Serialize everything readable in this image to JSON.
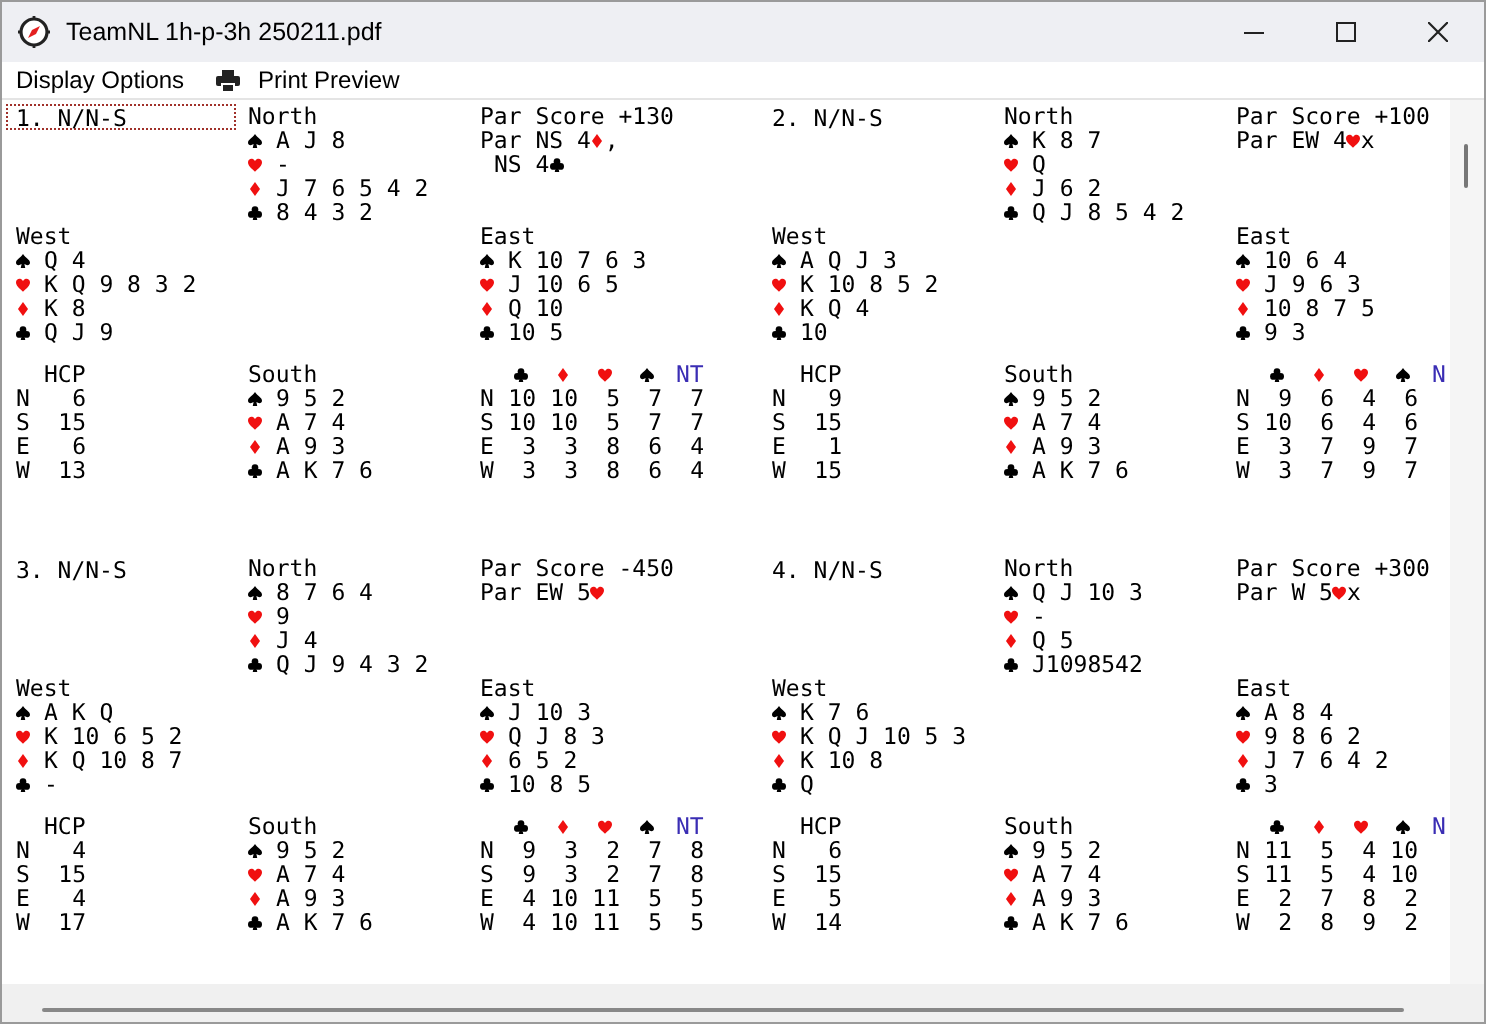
{
  "window": {
    "title": "TeamNL 1h-p-3h 250211.pdf"
  },
  "menu": [
    {
      "label": "Display Options",
      "kind": "text"
    },
    {
      "label": "Print Preview",
      "kind": "printer"
    }
  ],
  "boards": [
    {
      "header": "1. N/N-S",
      "focused": true,
      "north": {
        "label": "North",
        "suits": [
          {
            "kind": "spade",
            "cards": "A J 8"
          },
          {
            "kind": "heart",
            "cards": "-"
          },
          {
            "kind": "diamond",
            "cards": "J 7 6 5 4 2"
          },
          {
            "kind": "club",
            "cards": "8 4 3 2"
          }
        ]
      },
      "par": {
        "title": "Par Score +130",
        "contracts": [
          {
            "prefix": "Par NS 4",
            "kind": "diamond",
            "suffix": ","
          },
          {
            "prefix": "NS 4",
            "kind": "club"
          }
        ]
      },
      "west": {
        "label": "West",
        "suits": [
          {
            "kind": "spade",
            "cards": "Q 4"
          },
          {
            "kind": "heart",
            "cards": "K Q 9 8 3 2"
          },
          {
            "kind": "diamond",
            "cards": "K 8"
          },
          {
            "kind": "club",
            "cards": "Q J 9"
          }
        ]
      },
      "east": {
        "label": "East",
        "suits": [
          {
            "kind": "spade",
            "cards": "K 10 7 6 3"
          },
          {
            "kind": "heart",
            "cards": "J 10 6 5"
          },
          {
            "kind": "diamond",
            "cards": "Q 10"
          },
          {
            "kind": "club",
            "cards": "10 5"
          }
        ]
      },
      "hcp": {
        "title": "HCP",
        "rows": [
          {
            "seat": "N",
            "value": "6"
          },
          {
            "seat": "S",
            "value": "15"
          },
          {
            "seat": "E",
            "value": "6"
          },
          {
            "seat": "W",
            "value": "13"
          }
        ]
      },
      "south": {
        "label": "South",
        "suits": [
          {
            "kind": "spade",
            "cards": "9 5 2"
          },
          {
            "kind": "heart",
            "cards": "A 7 4"
          },
          {
            "kind": "diamond",
            "cards": "A 9 3"
          },
          {
            "kind": "club",
            "cards": "A K 7 6"
          }
        ]
      },
      "tricks": {
        "columns": [
          {
            "kind": "club"
          },
          {
            "kind": "diamond"
          },
          {
            "kind": "heart"
          },
          {
            "kind": "spade"
          },
          {
            "kind": "label",
            "label": "NT"
          }
        ],
        "rows": [
          {
            "seat": "N",
            "values": [
              "10",
              "10",
              "5",
              "7",
              "7"
            ]
          },
          {
            "seat": "S",
            "values": [
              "10",
              "10",
              "5",
              "7",
              "7"
            ]
          },
          {
            "seat": "E",
            "values": [
              "3",
              "3",
              "8",
              "6",
              "4"
            ]
          },
          {
            "seat": "W",
            "values": [
              "3",
              "3",
              "8",
              "6",
              "4"
            ]
          }
        ]
      }
    },
    {
      "header": "2. N/N-S",
      "focused": false,
      "north": {
        "label": "North",
        "suits": [
          {
            "kind": "spade",
            "cards": "K 8 7"
          },
          {
            "kind": "heart",
            "cards": "Q"
          },
          {
            "kind": "diamond",
            "cards": "J 6 2"
          },
          {
            "kind": "club",
            "cards": "Q J 8 5 4 2"
          }
        ]
      },
      "par": {
        "title": "Par Score +100",
        "contracts": [
          {
            "prefix": "Par EW 4",
            "kind": "heart",
            "suffix": "x"
          }
        ]
      },
      "west": {
        "label": "West",
        "suits": [
          {
            "kind": "spade",
            "cards": "A Q J 3"
          },
          {
            "kind": "heart",
            "cards": "K 10 8 5 2"
          },
          {
            "kind": "diamond",
            "cards": "K Q 4"
          },
          {
            "kind": "club",
            "cards": "10"
          }
        ]
      },
      "east": {
        "label": "East",
        "suits": [
          {
            "kind": "spade",
            "cards": "10 6 4"
          },
          {
            "kind": "heart",
            "cards": "J 9 6 3"
          },
          {
            "kind": "diamond",
            "cards": "10 8 7 5"
          },
          {
            "kind": "club",
            "cards": "9 3"
          }
        ]
      },
      "hcp": {
        "title": "HCP",
        "rows": [
          {
            "seat": "N",
            "value": "9"
          },
          {
            "seat": "S",
            "value": "15"
          },
          {
            "seat": "E",
            "value": "1"
          },
          {
            "seat": "W",
            "value": "15"
          }
        ]
      },
      "south": {
        "label": "South",
        "suits": [
          {
            "kind": "spade",
            "cards": "9 5 2"
          },
          {
            "kind": "heart",
            "cards": "A 7 4"
          },
          {
            "kind": "diamond",
            "cards": "A 9 3"
          },
          {
            "kind": "club",
            "cards": "A K 7 6"
          }
        ]
      },
      "tricks": {
        "columns": [
          {
            "kind": "club"
          },
          {
            "kind": "diamond"
          },
          {
            "kind": "heart"
          },
          {
            "kind": "spade"
          },
          {
            "kind": "label",
            "label": "N"
          }
        ],
        "rows": [
          {
            "seat": "N",
            "values": [
              "9",
              "6",
              "4",
              "6"
            ]
          },
          {
            "seat": "S",
            "values": [
              "10",
              "6",
              "4",
              "6"
            ]
          },
          {
            "seat": "E",
            "values": [
              "3",
              "7",
              "9",
              "7"
            ]
          },
          {
            "seat": "W",
            "values": [
              "3",
              "7",
              "9",
              "7"
            ]
          }
        ]
      }
    },
    {
      "header": "3. N/N-S",
      "focused": false,
      "north": {
        "label": "North",
        "suits": [
          {
            "kind": "spade",
            "cards": "8 7 6 4"
          },
          {
            "kind": "heart",
            "cards": "9"
          },
          {
            "kind": "diamond",
            "cards": "J 4"
          },
          {
            "kind": "club",
            "cards": "Q J 9 4 3 2"
          }
        ]
      },
      "par": {
        "title": "Par Score -450",
        "contracts": [
          {
            "prefix": "Par EW 5",
            "kind": "heart"
          }
        ]
      },
      "west": {
        "label": "West",
        "suits": [
          {
            "kind": "spade",
            "cards": "A K Q"
          },
          {
            "kind": "heart",
            "cards": "K 10 6 5 2"
          },
          {
            "kind": "diamond",
            "cards": "K Q 10 8 7"
          },
          {
            "kind": "club",
            "cards": "-"
          }
        ]
      },
      "east": {
        "label": "East",
        "suits": [
          {
            "kind": "spade",
            "cards": "J 10 3"
          },
          {
            "kind": "heart",
            "cards": "Q J 8 3"
          },
          {
            "kind": "diamond",
            "cards": "6 5 2"
          },
          {
            "kind": "club",
            "cards": "10 8 5"
          }
        ]
      },
      "hcp": {
        "title": "HCP",
        "rows": [
          {
            "seat": "N",
            "value": "4"
          },
          {
            "seat": "S",
            "value": "15"
          },
          {
            "seat": "E",
            "value": "4"
          },
          {
            "seat": "W",
            "value": "17"
          }
        ]
      },
      "south": {
        "label": "South",
        "suits": [
          {
            "kind": "spade",
            "cards": "9 5 2"
          },
          {
            "kind": "heart",
            "cards": "A 7 4"
          },
          {
            "kind": "diamond",
            "cards": "A 9 3"
          },
          {
            "kind": "club",
            "cards": "A K 7 6"
          }
        ]
      },
      "tricks": {
        "columns": [
          {
            "kind": "club"
          },
          {
            "kind": "diamond"
          },
          {
            "kind": "heart"
          },
          {
            "kind": "spade"
          },
          {
            "kind": "label",
            "label": "NT"
          }
        ],
        "rows": [
          {
            "seat": "N",
            "values": [
              "9",
              "3",
              "2",
              "7",
              "8"
            ]
          },
          {
            "seat": "S",
            "values": [
              "9",
              "3",
              "2",
              "7",
              "8"
            ]
          },
          {
            "seat": "E",
            "values": [
              "4",
              "10",
              "11",
              "5",
              "5"
            ]
          },
          {
            "seat": "W",
            "values": [
              "4",
              "10",
              "11",
              "5",
              "5"
            ]
          }
        ]
      }
    },
    {
      "header": "4. N/N-S",
      "focused": false,
      "north": {
        "label": "North",
        "suits": [
          {
            "kind": "spade",
            "cards": "Q J 10 3"
          },
          {
            "kind": "heart",
            "cards": "-"
          },
          {
            "kind": "diamond",
            "cards": "Q 5"
          },
          {
            "kind": "club",
            "cards": "J1098542"
          }
        ]
      },
      "par": {
        "title": "Par Score +300",
        "contracts": [
          {
            "prefix": "Par W 5",
            "kind": "heart",
            "suffix": "x"
          }
        ]
      },
      "west": {
        "label": "West",
        "suits": [
          {
            "kind": "spade",
            "cards": "K 7 6"
          },
          {
            "kind": "heart",
            "cards": "K Q J 10 5 3"
          },
          {
            "kind": "diamond",
            "cards": "K 10 8"
          },
          {
            "kind": "club",
            "cards": "Q"
          }
        ]
      },
      "east": {
        "label": "East",
        "suits": [
          {
            "kind": "spade",
            "cards": "A 8 4"
          },
          {
            "kind": "heart",
            "cards": "9 8 6 2"
          },
          {
            "kind": "diamond",
            "cards": "J 7 6 4 2"
          },
          {
            "kind": "club",
            "cards": "3"
          }
        ]
      },
      "hcp": {
        "title": "HCP",
        "rows": [
          {
            "seat": "N",
            "value": "6"
          },
          {
            "seat": "S",
            "value": "15"
          },
          {
            "seat": "E",
            "value": "5"
          },
          {
            "seat": "W",
            "value": "14"
          }
        ]
      },
      "south": {
        "label": "South",
        "suits": [
          {
            "kind": "spade",
            "cards": "9 5 2"
          },
          {
            "kind": "heart",
            "cards": "A 7 4"
          },
          {
            "kind": "diamond",
            "cards": "A 9 3"
          },
          {
            "kind": "club",
            "cards": "A K 7 6"
          }
        ]
      },
      "tricks": {
        "columns": [
          {
            "kind": "club"
          },
          {
            "kind": "diamond"
          },
          {
            "kind": "heart"
          },
          {
            "kind": "spade"
          },
          {
            "kind": "label",
            "label": "N"
          }
        ],
        "rows": [
          {
            "seat": "N",
            "values": [
              "11",
              "5",
              "4",
              "10"
            ]
          },
          {
            "seat": "S",
            "values": [
              "11",
              "5",
              "4",
              "10"
            ]
          },
          {
            "seat": "E",
            "values": [
              "2",
              "7",
              "8",
              "2"
            ]
          },
          {
            "seat": "W",
            "values": [
              "2",
              "8",
              "9",
              "2"
            ]
          }
        ]
      }
    }
  ]
}
